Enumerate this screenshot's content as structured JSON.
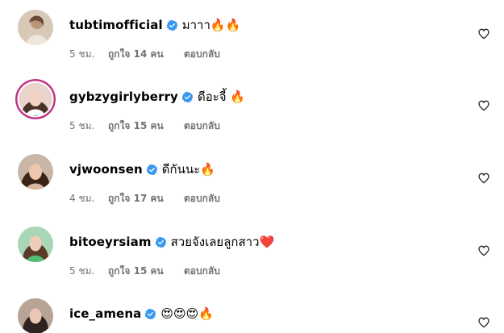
{
  "comments": [
    {
      "username": "tubtimofficial",
      "text": "มาาา🔥🔥",
      "time": "5 ชม.",
      "likes": "ถูกใจ 14 คน",
      "reply": "ตอบกลับ"
    },
    {
      "username": "gybzygirlyberry",
      "text": "ดีอะจี้ 🔥",
      "time": "5 ชม.",
      "likes": "ถูกใจ 15 คน",
      "reply": "ตอบกลับ"
    },
    {
      "username": "vjwoonsen",
      "text": "ดีกันนะ🔥",
      "time": "4 ชม.",
      "likes": "ถูกใจ 17 คน",
      "reply": "ตอบกลับ"
    },
    {
      "username": "bitoeyrsiam",
      "text": "สวยจังเลยลูกสาว❤️",
      "time": "5 ชม.",
      "likes": "ถูกใจ 15 คน",
      "reply": "ตอบกลับ"
    },
    {
      "username": "ice_amena",
      "text": "😍😍😍🔥",
      "time": "",
      "likes": "",
      "reply": ""
    }
  ],
  "colors": {
    "verified": "#3897f0",
    "meta": "#737373",
    "story_ring": "#c13584"
  }
}
